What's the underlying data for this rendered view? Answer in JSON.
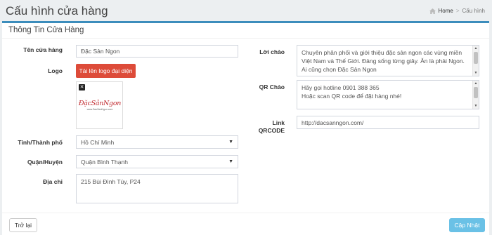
{
  "header": {
    "title": "Cấu hình cửa hàng",
    "breadcrumb": {
      "home": "Home",
      "current": "Cấu hình"
    }
  },
  "panel": {
    "title": "Thông Tin Cửa Hàng"
  },
  "form": {
    "store_name": {
      "label": "Tên cửa hàng",
      "value": "Đặc Sản Ngon"
    },
    "logo": {
      "label": "Logo",
      "upload_button": "Tải lên logo đại diện",
      "logo_text": "ĐặcSảnNgon",
      "logo_subtext": "www.DacSanNgon.com"
    },
    "province": {
      "label": "Tỉnh/Thành phố",
      "value": "Hồ Chí Minh"
    },
    "district": {
      "label": "Quận/Huyện",
      "value": "Quận Bình Thạnh"
    },
    "address": {
      "label": "Địa chỉ",
      "value": "215 Bùi Đình Túy, P24"
    },
    "greeting": {
      "label": "Lời chào",
      "value": "Chuyên phân phối và giới thiệu đặc sản ngon các vùng miền Việt Nam và Thế Giới. Đảng sống từng giây. Ăn là phải Ngon. Ai cũng chọn Đặc Sản Ngon"
    },
    "qr_greeting": {
      "label": "QR Chào",
      "line1": "Hãy gọi hotline 0901 388 365",
      "line2": "Hoặc scan QR code để đặt hàng nhé!"
    },
    "qr_link": {
      "label_line1": "Link",
      "label_line2": "QRCODE",
      "value": "http://dacsanngon.com/"
    }
  },
  "footer": {
    "back_button": "Trở lại",
    "update_button": "Cập Nhật"
  },
  "colors": {
    "accent": "#3c8dbc",
    "upload": "#dd4b39",
    "update": "#6ac1e6"
  }
}
